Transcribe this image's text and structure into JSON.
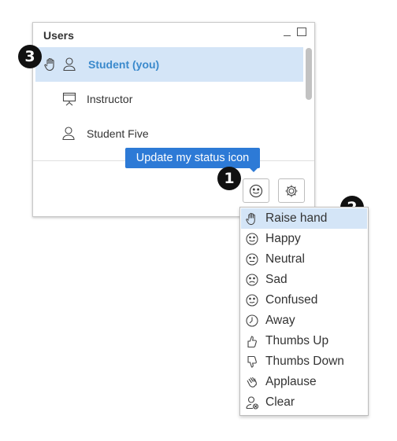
{
  "panel": {
    "title": "Users",
    "users": [
      {
        "name": "Student (you)",
        "status_icon": "raise-hand-icon",
        "role_icon": "person-icon",
        "selected": true
      },
      {
        "name": "Instructor",
        "role_icon": "presentation-icon",
        "selected": false
      },
      {
        "name": "Student Five",
        "role_icon": "person-icon",
        "selected": false
      }
    ],
    "toolbar": {
      "status_button_icon": "smiley-icon",
      "settings_button_icon": "gear-icon"
    }
  },
  "tooltip": {
    "text": "Update my status icon"
  },
  "badges": [
    "1",
    "2",
    "3"
  ],
  "status_menu": {
    "items": [
      {
        "label": "Raise hand",
        "icon": "raise-hand-icon",
        "highlighted": true
      },
      {
        "label": "Happy",
        "icon": "happy-icon"
      },
      {
        "label": "Neutral",
        "icon": "neutral-icon"
      },
      {
        "label": "Sad",
        "icon": "sad-icon"
      },
      {
        "label": "Confused",
        "icon": "confused-icon"
      },
      {
        "label": "Away",
        "icon": "clock-icon"
      },
      {
        "label": "Thumbs Up",
        "icon": "thumbs-up-icon"
      },
      {
        "label": "Thumbs Down",
        "icon": "thumbs-down-icon"
      },
      {
        "label": "Applause",
        "icon": "applause-icon"
      },
      {
        "label": "Clear",
        "icon": "clear-status-icon"
      }
    ]
  },
  "colors": {
    "accent": "#2d7ad6",
    "selected_bg": "#d4e5f7",
    "selected_text": "#3a89cc",
    "badge": "#111111"
  }
}
